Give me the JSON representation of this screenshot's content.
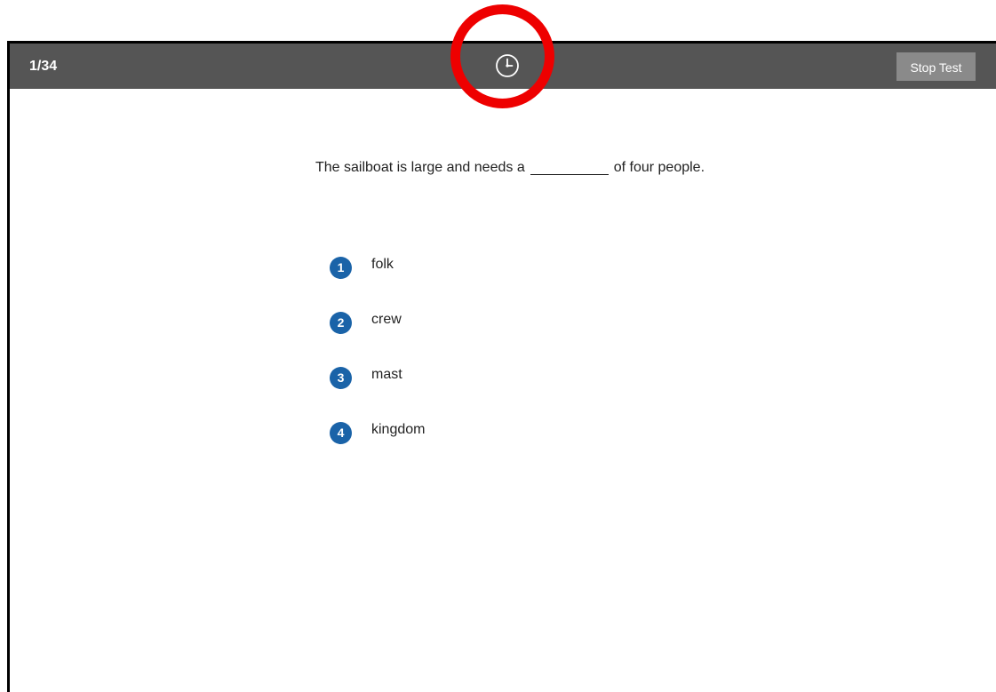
{
  "header": {
    "counter": "1/34",
    "stop_label": "Stop Test",
    "timer_icon": "clock-icon"
  },
  "question": {
    "before_blank": "The sailboat is large and needs a",
    "after_blank": "of four people."
  },
  "options": [
    {
      "number": "1",
      "label": "folk"
    },
    {
      "number": "2",
      "label": "crew"
    },
    {
      "number": "3",
      "label": "mast"
    },
    {
      "number": "4",
      "label": "kingdom"
    }
  ],
  "colors": {
    "topbar": "#555555",
    "stop_button": "#8a8a8a",
    "option_badge": "#1a63a8",
    "highlight_ring": "#ee0000"
  }
}
